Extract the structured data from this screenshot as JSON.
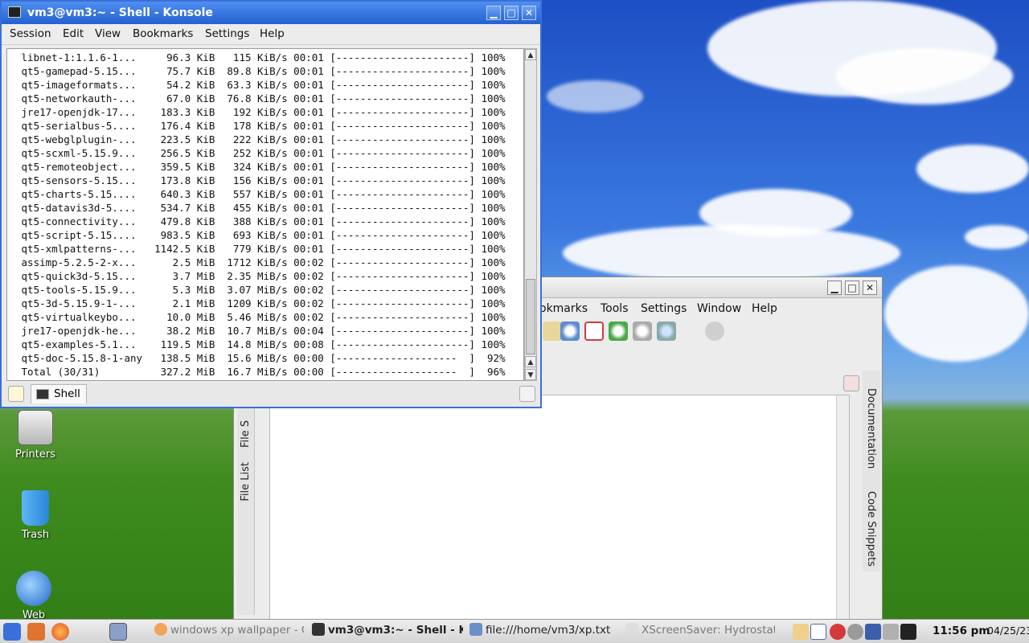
{
  "desktop": {
    "icons": [
      {
        "label": "Printers"
      },
      {
        "label": "Trash"
      },
      {
        "label": "Web"
      }
    ]
  },
  "konsole": {
    "title": "vm3@vm3:~ - Shell - Konsole",
    "window_buttons": {
      "minimize": "▁",
      "maximize": "□",
      "close": "✕"
    },
    "menu": [
      "Session",
      "Edit",
      "View",
      "Bookmarks",
      "Settings",
      "Help"
    ],
    "terminal_lines": [
      " libnet-1:1.1.6-1...     96.3 KiB   115 KiB/s 00:01 [----------------------] 100%",
      " qt5-gamepad-5.15...     75.7 KiB  89.8 KiB/s 00:01 [----------------------] 100%",
      " qt5-imageformats...     54.2 KiB  63.3 KiB/s 00:01 [----------------------] 100%",
      " qt5-networkauth-...     67.0 KiB  76.8 KiB/s 00:01 [----------------------] 100%",
      " jre17-openjdk-17...    183.3 KiB   192 KiB/s 00:01 [----------------------] 100%",
      " qt5-serialbus-5....    176.4 KiB   178 KiB/s 00:01 [----------------------] 100%",
      " qt5-webglplugin-...    223.5 KiB   222 KiB/s 00:01 [----------------------] 100%",
      " qt5-scxml-5.15.9...    256.5 KiB   252 KiB/s 00:01 [----------------------] 100%",
      " qt5-remoteobject...    359.5 KiB   324 KiB/s 00:01 [----------------------] 100%",
      " qt5-sensors-5.15...    173.8 KiB   156 KiB/s 00:01 [----------------------] 100%",
      " qt5-charts-5.15....    640.3 KiB   557 KiB/s 00:01 [----------------------] 100%",
      " qt5-datavis3d-5....    534.7 KiB   455 KiB/s 00:01 [----------------------] 100%",
      " qt5-connectivity...    479.8 KiB   388 KiB/s 00:01 [----------------------] 100%",
      " qt5-script-5.15....    983.5 KiB   693 KiB/s 00:01 [----------------------] 100%",
      " qt5-xmlpatterns-...   1142.5 KiB   779 KiB/s 00:01 [----------------------] 100%",
      " assimp-5.2.5-2-x...      2.5 MiB  1712 KiB/s 00:02 [----------------------] 100%",
      " qt5-quick3d-5.15...      3.7 MiB  2.35 MiB/s 00:02 [----------------------] 100%",
      " qt5-tools-5.15.9...      5.3 MiB  3.07 MiB/s 00:02 [----------------------] 100%",
      " qt5-3d-5.15.9-1-...      2.1 MiB  1209 KiB/s 00:02 [----------------------] 100%",
      " qt5-virtualkeybo...     10.0 MiB  5.46 MiB/s 00:02 [----------------------] 100%",
      " jre17-openjdk-he...     38.2 MiB  10.7 MiB/s 00:04 [----------------------] 100%",
      " qt5-examples-5.1...    119.5 MiB  14.8 MiB/s 00:08 [----------------------] 100%",
      " qt5-doc-5.15.8-1-any   138.5 MiB  15.6 MiB/s 00:00 [--------------------  ]  92%",
      " Total (30/31)          327.2 MiB  16.7 MiB/s 00:00 [--------------------  ]  96%"
    ],
    "tab_label": "Shell"
  },
  "editor_window": {
    "window_buttons": {
      "minimize": "▁",
      "maximize": "□",
      "close": "✕"
    },
    "menu": [
      "okmarks",
      "Tools",
      "Settings",
      "Window",
      "Help"
    ],
    "left_tabs": [
      "File List",
      "File S"
    ],
    "right_tabs": [
      "Documentation",
      "Code Snippets"
    ]
  },
  "taskbar": {
    "tasks": [
      {
        "label": "windows xp wallpaper - G"
      },
      {
        "label": "vm3@vm3:~ - Shell - K"
      },
      {
        "label": "file:///home/vm3/xp.txt"
      },
      {
        "label": "XScreenSaver: Hydrostat"
      }
    ],
    "clock": {
      "time": "11:56 pm",
      "date": "04/25/23"
    }
  },
  "colors": {
    "konsole_title": "#2461d0",
    "sky": "#3a78e0",
    "grass": "#3f8b1e"
  }
}
